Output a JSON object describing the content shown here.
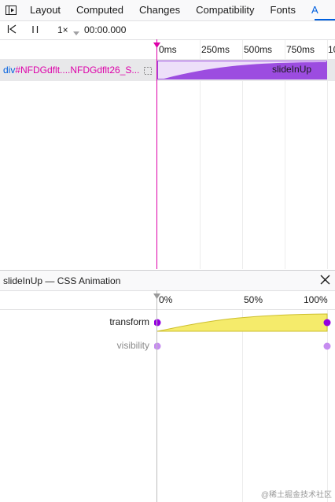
{
  "tabs": {
    "items": [
      "Layout",
      "Computed",
      "Changes",
      "Compatibility",
      "Fonts"
    ],
    "partial": "A"
  },
  "toolbar": {
    "speed": "1×",
    "time": "00:00.000"
  },
  "timeline": {
    "ticks": [
      "0ms",
      "250ms",
      "500ms",
      "750ms",
      "10"
    ],
    "row": {
      "tag": "div",
      "id": "#NFDGdflt....NFDGdflt26_S..."
    },
    "animation_name": "slideInUp"
  },
  "details": {
    "title": "slideInUp — CSS Animation",
    "progress_ticks": [
      "0%",
      "50%",
      "100%"
    ],
    "properties": [
      {
        "name": "transform"
      },
      {
        "name": "visibility"
      }
    ]
  },
  "watermark": "@稀土掘金技术社区",
  "colors": {
    "accent": "#0060df",
    "scrubber": "#dd00a9",
    "animation_fill": "#9c4ce0",
    "transform_fill": "#f5eb6b",
    "keyframe": "#9400e0"
  }
}
